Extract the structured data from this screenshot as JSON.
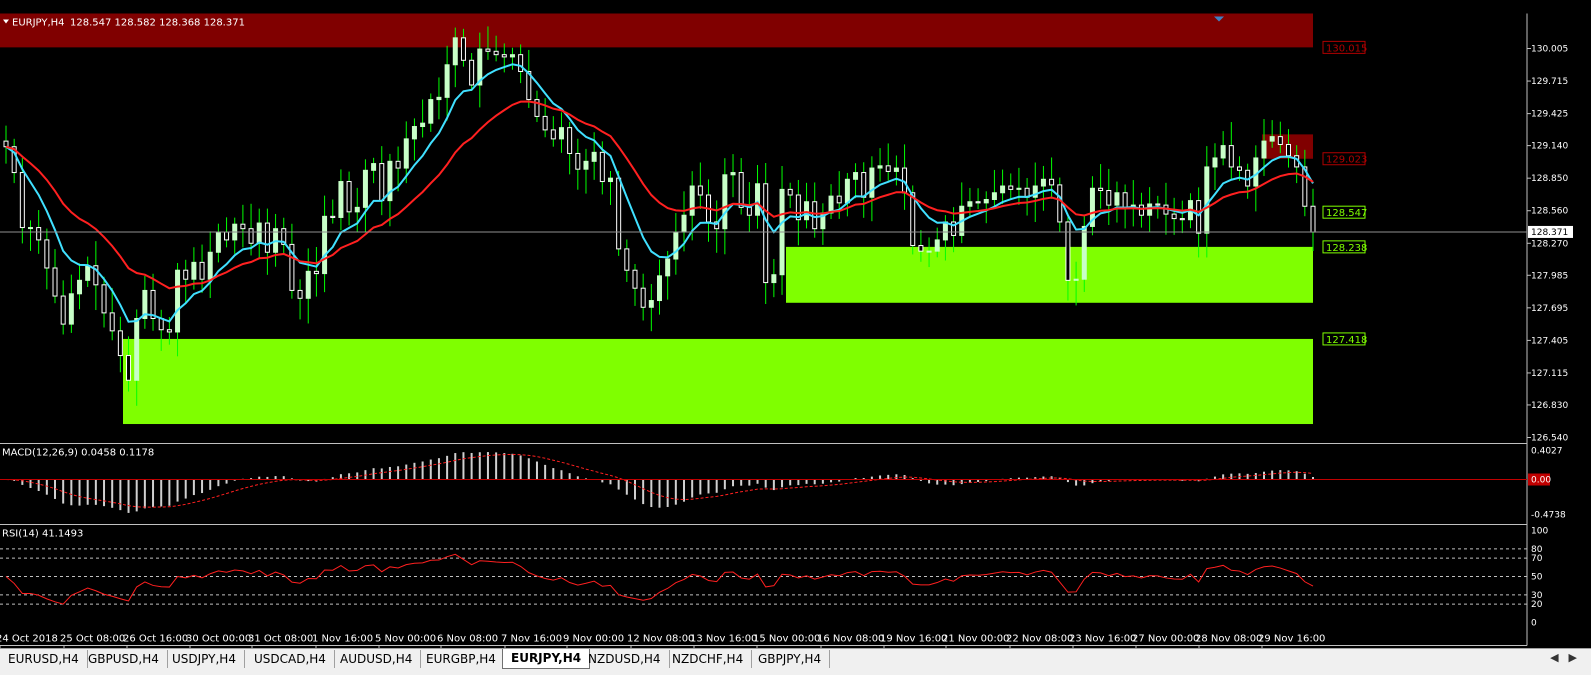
{
  "window": {
    "symbol_line": "EURJPY,H4",
    "ohlc": "128.547 128.582 128.368 128.371"
  },
  "price_axis": {
    "ticks": [
      "130.005",
      "129.715",
      "129.425",
      "129.140",
      "128.850",
      "128.560",
      "128.270",
      "127.985",
      "127.695",
      "127.405",
      "127.115",
      "126.830",
      "126.540"
    ],
    "current_price": "128.371"
  },
  "price_labels": [
    {
      "text": "130.015",
      "kind": "resistance"
    },
    {
      "text": "129.023",
      "kind": "resistance"
    },
    {
      "text": "128.547",
      "kind": "support"
    },
    {
      "text": "128.238",
      "kind": "support"
    },
    {
      "text": "127.418",
      "kind": "support"
    }
  ],
  "zones": [
    {
      "name": "resistance-zone-top",
      "from": 130.015,
      "to": 130.4,
      "color": "#800000"
    },
    {
      "name": "resistance-zone-small",
      "from": 129.023,
      "to": 129.24,
      "color": "#800000"
    },
    {
      "name": "support-zone-upper",
      "from": 127.74,
      "to": 128.238,
      "color": "#7fff00"
    },
    {
      "name": "support-zone-lower",
      "from": 126.66,
      "to": 127.418,
      "color": "#7fff00"
    }
  ],
  "macd": {
    "label": "MACD(12,26,9) 0.0458 0.1178",
    "axis": [
      "0.4027",
      "0.00",
      "-0.4738"
    ]
  },
  "rsi": {
    "label": "RSI(14) 41.1493",
    "axis": [
      "100",
      "80",
      "70",
      "50",
      "30",
      "20",
      "0"
    ]
  },
  "time_axis": [
    "24 Oct 2018",
    "25 Oct 08:00",
    "26 Oct 16:00",
    "30 Oct 00:00",
    "31 Oct 08:00",
    "1 Nov 16:00",
    "5 Nov 00:00",
    "6 Nov 08:00",
    "7 Nov 16:00",
    "9 Nov 00:00",
    "12 Nov 08:00",
    "13 Nov 16:00",
    "15 Nov 00:00",
    "16 Nov 08:00",
    "19 Nov 16:00",
    "21 Nov 00:00",
    "22 Nov 08:00",
    "23 Nov 16:00",
    "27 Nov 00:00",
    "28 Nov 08:00",
    "29 Nov 16:00"
  ],
  "tabs": [
    "EURUSD,H4",
    "GBPUSD,H4",
    "USDJPY,H4",
    "USDCAD,H4",
    "AUDUSD,H4",
    "EURGBP,H4",
    "EURJPY,H4",
    "NZDUSD,H4",
    "NZDCHF,H4",
    "GBPJPY,H4"
  ],
  "active_tab": "EURJPY,H4",
  "colors": {
    "bull": "#c8ffc8",
    "bear": "#ffffff",
    "wick": "#00ff00",
    "fast_ma": "#40e0ff",
    "slow_ma": "#ff2020",
    "resistance": "#800000",
    "support": "#7fff00",
    "rsi": "#ff2020",
    "macd_signal": "#ff2020"
  },
  "chart_data": {
    "type": "candlestick",
    "series_close": [
      129.13,
      128.9,
      128.41,
      128.41,
      128.3,
      128.05,
      127.8,
      127.55,
      127.82,
      127.94,
      128.07,
      127.9,
      127.65,
      127.49,
      127.27,
      127.05,
      127.6,
      127.85,
      127.6,
      127.5,
      127.48,
      128.03,
      127.95,
      128.1,
      127.95,
      128.19,
      128.37,
      128.3,
      128.44,
      128.4,
      128.27,
      128.45,
      128.19,
      128.4,
      128.26,
      127.85,
      127.78,
      128.02,
      128.0,
      128.51,
      128.5,
      128.82,
      128.55,
      128.59,
      128.92,
      128.98,
      128.65,
      129.0,
      128.94,
      129.2,
      129.31,
      129.34,
      129.55,
      129.57,
      129.86,
      130.1,
      129.9,
      129.68,
      130.0,
      129.98,
      129.95,
      129.93,
      129.95,
      129.8,
      129.55,
      129.4,
      129.28,
      129.2,
      129.3,
      129.07,
      128.93,
      129.0,
      129.08,
      128.82,
      128.85,
      128.22,
      128.03,
      127.87,
      127.7,
      127.76,
      127.98,
      128.13,
      128.37,
      128.52,
      128.78,
      128.7,
      128.46,
      128.4,
      128.88,
      128.9,
      128.59,
      128.52,
      128.8,
      127.92,
      127.99,
      128.75,
      128.7,
      128.48,
      128.64,
      128.4,
      128.54,
      128.69,
      128.63,
      128.84,
      128.9,
      128.68,
      128.94,
      128.96,
      128.91,
      128.94,
      128.72,
      128.25,
      128.2,
      128.2,
      128.3,
      128.46,
      128.34,
      128.6,
      128.64,
      128.63,
      128.66,
      128.72,
      128.78,
      128.75,
      128.76,
      128.68,
      128.78,
      128.84,
      128.79,
      128.46,
      127.94,
      127.95,
      128.42,
      128.76,
      128.74,
      128.61,
      128.72,
      128.58,
      128.61,
      128.52,
      128.62,
      128.61,
      128.53,
      128.49,
      128.48,
      128.65,
      128.36,
      128.95,
      129.03,
      129.14,
      128.95,
      128.92,
      128.78,
      129.03,
      129.18,
      129.22,
      129.15,
      129.05,
      128.95,
      128.6,
      128.37
    ]
  }
}
